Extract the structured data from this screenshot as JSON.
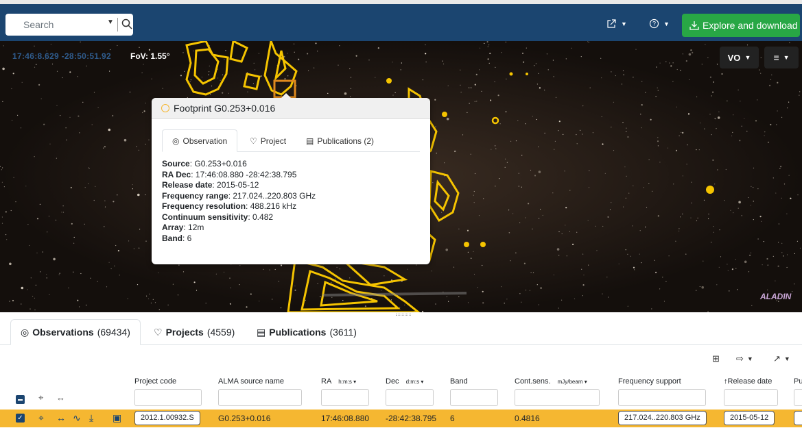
{
  "header": {
    "search_placeholder": "Search",
    "explore_label": "Explore and download",
    "share_icon": "share-icon",
    "help_icon": "help-icon"
  },
  "sky": {
    "coords": "17:46:8.629 -28:50:51.92",
    "fov": "FoV: 1.55°",
    "vo_label": "VO",
    "logo": "ALADIN"
  },
  "popup": {
    "title": "Footprint G0.253+0.016",
    "tabs": [
      {
        "label": "Observation",
        "icon": "eye-icon"
      },
      {
        "label": "Project",
        "icon": "bulb-icon"
      },
      {
        "label": "Publications (2)",
        "icon": "document-icon"
      }
    ],
    "fields": [
      {
        "label": "Source",
        "value": ": G0.253+0.016"
      },
      {
        "label": "RA Dec",
        "value": ": 17:46:08.880 -28:42:38.795"
      },
      {
        "label": "Release date",
        "value": ": 2015-05-12"
      },
      {
        "label": "Frequency range",
        "value": ": 217.024..220.803 GHz"
      },
      {
        "label": "Frequency resolution",
        "value": ": 488.216 kHz"
      },
      {
        "label": "Continuum sensitivity",
        "value": ": 0.482"
      },
      {
        "label": "Array",
        "value": ": 12m"
      },
      {
        "label": "Band",
        "value": ": 6"
      }
    ]
  },
  "results": {
    "tabs": [
      {
        "label": "Observations",
        "count": " (69434)"
      },
      {
        "label": "Projects",
        "count": " (4559)"
      },
      {
        "label": "Publications",
        "count": " (3611)"
      }
    ],
    "columns": {
      "project_code": "Project code",
      "source_name": "ALMA source name",
      "ra": "RA",
      "ra_unit": "h:m:s ▾",
      "dec": "Dec",
      "dec_unit": "d:m:s ▾",
      "band": "Band",
      "sens": "Cont.sens.",
      "sens_unit": "mJy/beam ▾",
      "freq": "Frequency support",
      "release": "↑Release date",
      "pub": "Pu"
    },
    "row": {
      "project_code": "2012.1.00932.S",
      "source_name": "G0.253+0.016",
      "ra": "17:46:08.880",
      "dec": "-28:42:38.795",
      "band": "6",
      "sens": "0.4816",
      "freq": "217.024..220.803 GHz",
      "release": "2015-05-12"
    }
  },
  "colors": {
    "header_bg": "#1b4570",
    "explore_btn": "#28a745",
    "footprint": "#f5c400",
    "selected_row": "#f5b731"
  }
}
